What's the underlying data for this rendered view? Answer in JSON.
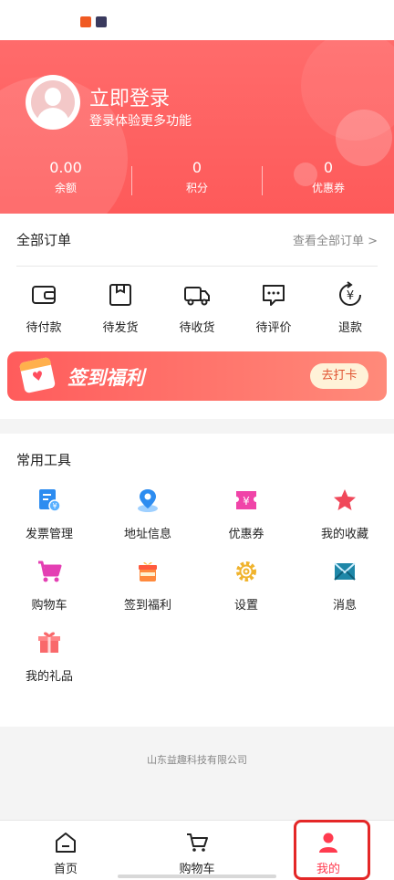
{
  "header": {
    "login_title": "立即登录",
    "login_subtitle": "登录体验更多功能",
    "stats": [
      {
        "value": "0.00",
        "label": "余额"
      },
      {
        "value": "0",
        "label": "积分"
      },
      {
        "value": "0",
        "label": "优惠券"
      }
    ]
  },
  "orders": {
    "title": "全部订单",
    "view_all": "查看全部订单 >",
    "items": [
      {
        "label": "待付款",
        "icon": "wallet-icon"
      },
      {
        "label": "待发货",
        "icon": "box-icon"
      },
      {
        "label": "待收货",
        "icon": "truck-icon"
      },
      {
        "label": "待评价",
        "icon": "comment-icon"
      },
      {
        "label": "退款",
        "icon": "refund-icon"
      }
    ]
  },
  "banner": {
    "title": "签到福利",
    "button": "去打卡"
  },
  "tools": {
    "title": "常用工具",
    "items": [
      {
        "label": "发票管理",
        "icon": "invoice-icon"
      },
      {
        "label": "地址信息",
        "icon": "location-icon"
      },
      {
        "label": "优惠券",
        "icon": "coupon-icon"
      },
      {
        "label": "我的收藏",
        "icon": "star-icon"
      },
      {
        "label": "购物车",
        "icon": "cart-icon"
      },
      {
        "label": "签到福利",
        "icon": "gift-checkin-icon"
      },
      {
        "label": "设置",
        "icon": "gear-icon"
      },
      {
        "label": "消息",
        "icon": "mail-icon"
      },
      {
        "label": "我的礼品",
        "icon": "gift-icon"
      }
    ]
  },
  "footer": {
    "company": "山东益趣科技有限公司"
  },
  "tabbar": {
    "items": [
      {
        "label": "首页",
        "icon": "home-icon"
      },
      {
        "label": "购物车",
        "icon": "cart-icon"
      },
      {
        "label": "我的",
        "icon": "user-icon"
      }
    ]
  },
  "colors": {
    "primary": "#fe5a5a",
    "active_tab": "#ff3b4f",
    "highlight_border": "#e42727"
  }
}
